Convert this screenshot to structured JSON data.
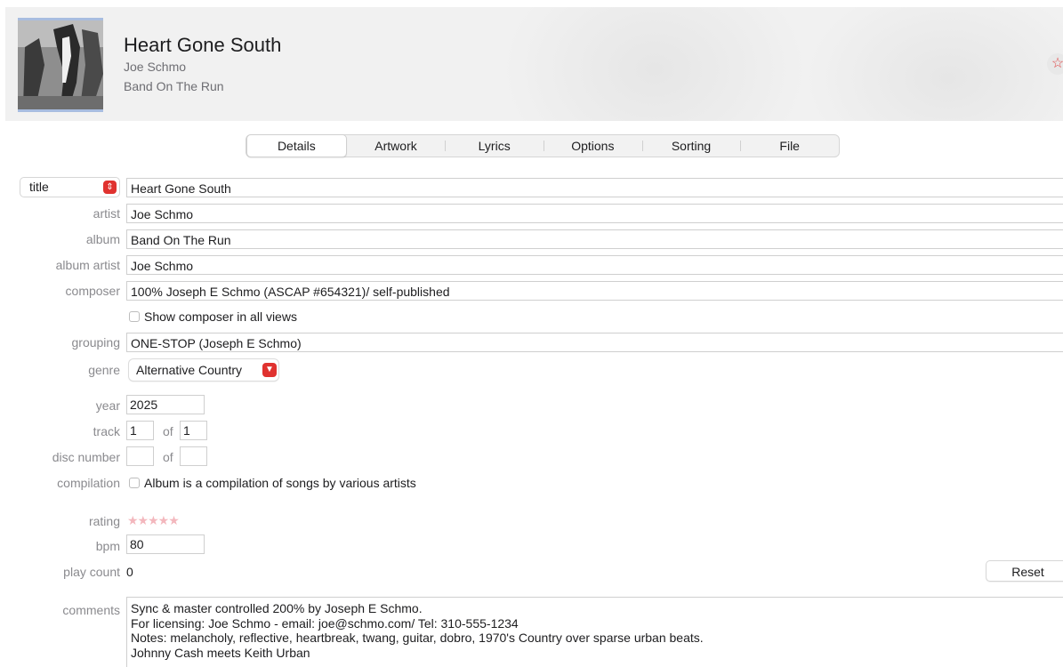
{
  "header": {
    "title": "Heart Gone South",
    "artist": "Joe Schmo",
    "album": "Band On The Run",
    "love_icon": "star-icon"
  },
  "tabs": [
    {
      "label": "Details",
      "active": true
    },
    {
      "label": "Artwork",
      "active": false
    },
    {
      "label": "Lyrics",
      "active": false
    },
    {
      "label": "Options",
      "active": false
    },
    {
      "label": "Sorting",
      "active": false
    },
    {
      "label": "File",
      "active": false
    }
  ],
  "form": {
    "field_selector": {
      "value": "title"
    },
    "title": {
      "value": "Heart Gone South"
    },
    "artist": {
      "label": "artist",
      "value": "Joe Schmo"
    },
    "album": {
      "label": "album",
      "value": "Band On The Run"
    },
    "album_artist": {
      "label": "album artist",
      "value": "Joe Schmo"
    },
    "composer": {
      "label": "composer",
      "value": "100% Joseph E Schmo (ASCAP #654321)/ self-published"
    },
    "show_composer": {
      "label": "Show composer in all views",
      "checked": false
    },
    "grouping": {
      "label": "grouping",
      "value": "ONE-STOP (Joseph E Schmo)"
    },
    "genre": {
      "label": "genre",
      "value": "Alternative Country"
    },
    "year": {
      "label": "year",
      "value": "2025"
    },
    "track": {
      "label": "track",
      "value": "1",
      "of_label": "of",
      "total": "1"
    },
    "disc_number": {
      "label": "disc number",
      "value": "",
      "of_label": "of",
      "total": ""
    },
    "compilation": {
      "label": "compilation",
      "checkbox_label": "Album is a compilation of songs by various artists",
      "checked": false
    },
    "rating": {
      "label": "rating",
      "stars": "★★★★★",
      "value": 0,
      "max": 5
    },
    "bpm": {
      "label": "bpm",
      "value": "80"
    },
    "play_count": {
      "label": "play count",
      "value": "0",
      "reset_label": "Reset"
    },
    "comments": {
      "label": "comments",
      "lines": [
        "Sync & master controlled 200% by Joseph E Schmo.",
        "For licensing: Joe Schmo - email: joe@schmo.com/ Tel: 310-555-1234",
        "Notes: melancholy, reflective, heartbreak, twang, guitar, dobro, 1970's Country over sparse urban beats.",
        "Johnny Cash meets Keith Urban"
      ]
    }
  },
  "colors": {
    "accent": "#e0322f",
    "rating_star": "#f3b7bd",
    "label_gray": "#8a8a8e"
  }
}
